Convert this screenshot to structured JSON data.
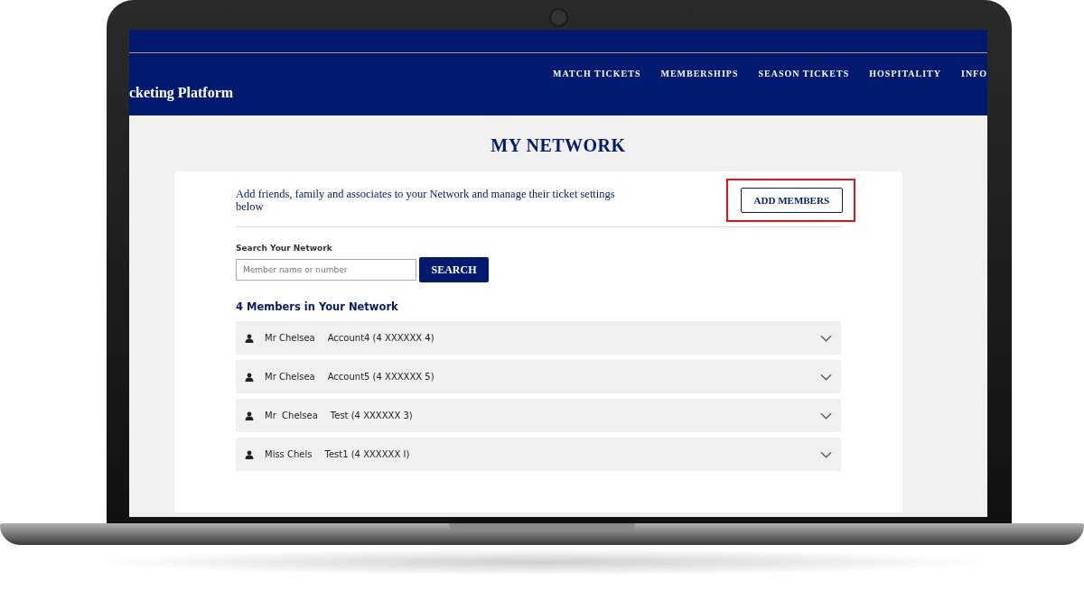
{
  "header": {
    "site_title": "cketing Platform",
    "nav": [
      {
        "label": "MATCH TICKETS"
      },
      {
        "label": "MEMBERSHIPS"
      },
      {
        "label": "SEASON TICKETS"
      },
      {
        "label": "HOSPITALITY"
      },
      {
        "label": "INFO"
      }
    ]
  },
  "page_title": "MY NETWORK",
  "intro": "Add friends, family and associates to your Network and manage their ticket settings below",
  "add_button": {
    "label": "ADD MEMBERS",
    "highlighted": true
  },
  "search": {
    "label": "Search Your Network",
    "placeholder": "Member name or number",
    "button": "SEARCH"
  },
  "members_heading": "4 Members in Your Network",
  "members": [
    {
      "name": "Mr Chelsea",
      "account": "Account4 (4 XXXXXX 4)",
      "expanded": false
    },
    {
      "name": "Mr Chelsea",
      "account": "Account5 (4 XXXXXX 5)",
      "expanded": false
    },
    {
      "name": "Mr  Chelsea",
      "account": "Test (4 XXXXXX 3)",
      "expanded": false
    },
    {
      "name": "Miss Chels",
      "account": "Test1 (4 XXXXXX I)",
      "expanded": false
    }
  ]
}
